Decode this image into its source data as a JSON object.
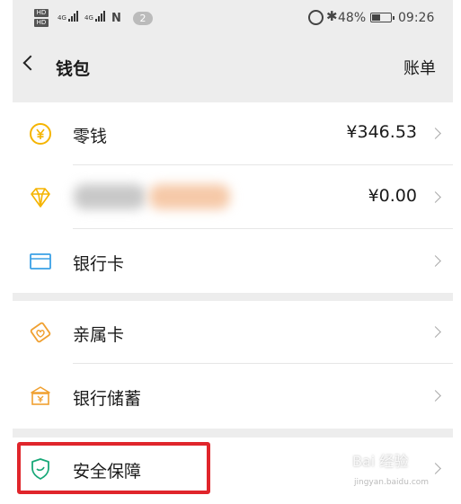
{
  "status_bar": {
    "hd1": "HD",
    "hd2": "HD",
    "net1": "4G",
    "net2": "4G",
    "nfc": "N",
    "notification_count": "2",
    "battery_percent": "48%",
    "battery_level": 0.48,
    "time": "09:26"
  },
  "header": {
    "title": "钱包",
    "bill_link": "账单"
  },
  "rows": [
    {
      "label": "零钱",
      "value": "¥346.53",
      "icon": "yuan-coin-icon"
    },
    {
      "label": "",
      "value": "¥0.00",
      "icon": "diamond-icon"
    },
    {
      "label": "银行卡",
      "value": "",
      "icon": "bank-card-icon"
    },
    {
      "label": "亲属卡",
      "value": "",
      "icon": "family-card-icon"
    },
    {
      "label": "银行储蓄",
      "value": "",
      "icon": "bank-savings-icon"
    },
    {
      "label": "安全保障",
      "value": "",
      "icon": "shield-icon"
    }
  ],
  "colors": {
    "accent_yellow": "#f5b400",
    "accent_blue": "#3aa0e6",
    "accent_orange": "#f0a030",
    "accent_green": "#18a878",
    "highlight_red": "#e0252b",
    "background_gray": "#ededed"
  },
  "watermark": {
    "text": "Bai 经验",
    "url": "jingyan.baidu.com"
  }
}
